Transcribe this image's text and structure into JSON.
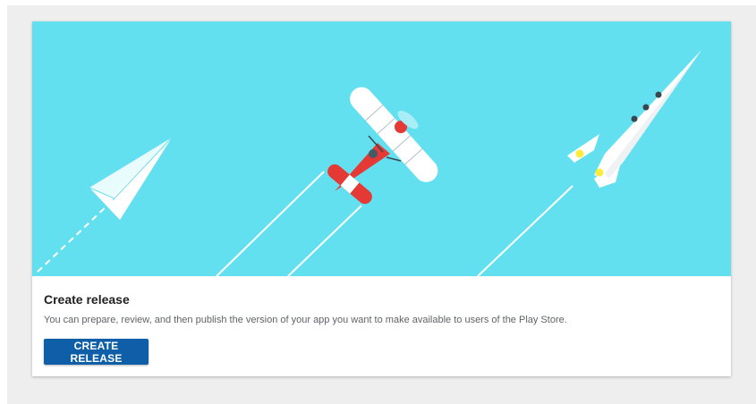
{
  "card": {
    "title": "Create release",
    "description": "You can prepare, review, and then publish the version of your app you want to make available to users of the Play Store.",
    "button_label": "CREATE RELEASE"
  },
  "colors": {
    "hero_background": "#62e0f0",
    "button_background": "#0f5ea8",
    "plane_red": "#e53935"
  },
  "illustration": {
    "items": [
      "paper-plane-icon",
      "biplane-icon",
      "rocket-icon"
    ]
  }
}
